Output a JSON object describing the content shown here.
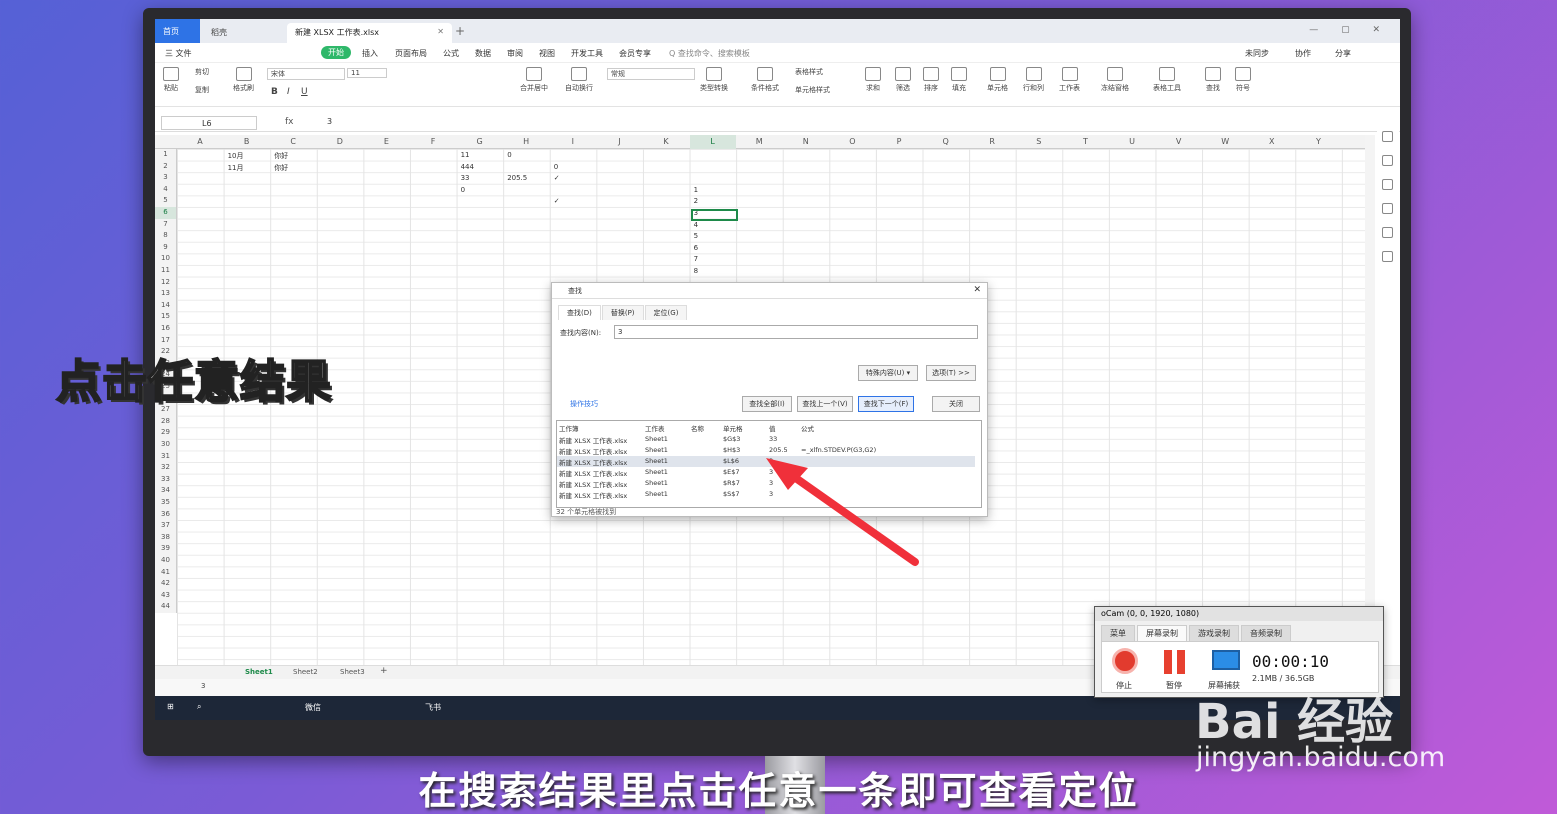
{
  "tabs": {
    "home": "首页",
    "t2": "稻壳",
    "t3": "新建 XLSX 工作表.xlsx"
  },
  "menu": [
    "三 文件",
    "开始",
    "插入",
    "页面布局",
    "公式",
    "数据",
    "审阅",
    "视图",
    "开发工具",
    "会员专享",
    "Q 查找命令、搜索模板"
  ],
  "menu_right": [
    "未同步",
    "协作",
    "分享"
  ],
  "ribbon": [
    "粘贴",
    "剪切",
    "复制",
    "格式刷",
    "宋体",
    "11",
    "B",
    "I",
    "U",
    "合并居中",
    "自动换行",
    "常规",
    "类型转换",
    "条件格式",
    "表格样式",
    "单元格样式",
    "求和",
    "筛选",
    "排序",
    "填充",
    "单元格",
    "行和列",
    "工作表",
    "冻结窗格",
    "表格工具",
    "查找",
    "符号"
  ],
  "formula": {
    "namebox": "L6",
    "fx": "fx",
    "value": "3"
  },
  "columns": [
    "A",
    "B",
    "C",
    "D",
    "E",
    "F",
    "G",
    "H",
    "I",
    "J",
    "K",
    "L",
    "M",
    "N",
    "O",
    "P",
    "Q",
    "R",
    "S",
    "T",
    "U",
    "V",
    "W",
    "X",
    "Y"
  ],
  "rows": [
    "1",
    "2",
    "3",
    "4",
    "5",
    "6",
    "7",
    "8",
    "9",
    "10",
    "11",
    "12",
    "13",
    "14",
    "15",
    "16",
    "17",
    "22",
    "23",
    "24",
    "25",
    "26",
    "27",
    "28",
    "29",
    "30",
    "31",
    "32",
    "33",
    "34",
    "35",
    "36",
    "37",
    "38",
    "39",
    "40",
    "41",
    "42",
    "43",
    "44"
  ],
  "cells": [
    {
      "c": 1,
      "r": 0,
      "t": "10月"
    },
    {
      "c": 1,
      "r": 1,
      "t": "11月"
    },
    {
      "c": 2,
      "r": 0,
      "t": "你好"
    },
    {
      "c": 2,
      "r": 1,
      "t": "你好"
    },
    {
      "c": 6,
      "r": 0,
      "t": "11"
    },
    {
      "c": 6,
      "r": 1,
      "t": "444"
    },
    {
      "c": 6,
      "r": 2,
      "t": "33"
    },
    {
      "c": 6,
      "r": 3,
      "t": "0"
    },
    {
      "c": 7,
      "r": 0,
      "t": "0"
    },
    {
      "c": 7,
      "r": 2,
      "t": "205.5"
    },
    {
      "c": 8,
      "r": 2,
      "t": "✓"
    },
    {
      "c": 8,
      "r": 4,
      "t": "✓"
    },
    {
      "c": 8,
      "r": 1,
      "t": "0"
    },
    {
      "c": 11,
      "r": 3,
      "t": "1"
    },
    {
      "c": 11,
      "r": 4,
      "t": "2"
    },
    {
      "c": 11,
      "r": 5,
      "t": "3"
    },
    {
      "c": 11,
      "r": 6,
      "t": "4"
    },
    {
      "c": 11,
      "r": 7,
      "t": "5"
    },
    {
      "c": 11,
      "r": 8,
      "t": "6"
    },
    {
      "c": 11,
      "r": 9,
      "t": "7"
    },
    {
      "c": 11,
      "r": 10,
      "t": "8"
    }
  ],
  "sheets": [
    "Sheet1",
    "Sheet2",
    "Sheet3",
    "+"
  ],
  "status": "3",
  "find_dialog": {
    "title": "查找",
    "tabs": [
      "查找(D)",
      "替换(P)",
      "定位(G)"
    ],
    "label": "查找内容(N):",
    "value": "3",
    "special_btn": "特殊内容(U) ▾",
    "options_btn": "选项(T) >>",
    "tips": "操作技巧",
    "btn_all": "查找全部(I)",
    "btn_prev": "查找上一个(V)",
    "btn_next": "查找下一个(F)",
    "btn_close": "关闭",
    "headers": [
      "工作簿",
      "工作表",
      "名称",
      "单元格",
      "值",
      "公式"
    ],
    "results": [
      [
        "新建 XLSX 工作表.xlsx",
        "Sheet1",
        "",
        "$G$3",
        "33",
        ""
      ],
      [
        "新建 XLSX 工作表.xlsx",
        "Sheet1",
        "",
        "$H$3",
        "205.5",
        "=_xlfn.STDEV.P(G3,G2)"
      ],
      [
        "新建 XLSX 工作表.xlsx",
        "Sheet1",
        "",
        "$L$6",
        "3",
        ""
      ],
      [
        "新建 XLSX 工作表.xlsx",
        "Sheet1",
        "",
        "$E$7",
        "3",
        ""
      ],
      [
        "新建 XLSX 工作表.xlsx",
        "Sheet1",
        "",
        "$R$7",
        "3",
        ""
      ],
      [
        "新建 XLSX 工作表.xlsx",
        "Sheet1",
        "",
        "$S$7",
        "3",
        ""
      ]
    ],
    "footer": "32 个单元格被找到"
  },
  "ocam": {
    "title": "oCam (0, 0, 1920, 1080)",
    "tabs": [
      "菜单",
      "屏幕录制",
      "游戏录制",
      "音频录制"
    ],
    "labels": [
      "停止",
      "暂停",
      "屏幕捕获"
    ],
    "time": "00:00:10",
    "size": "2.1MB / 36.5GB"
  },
  "taskbar": [
    "微信",
    "飞书"
  ],
  "caption_left": "点击任意结果",
  "caption_bottom": "在搜索结果里点击任意一条即可查看定位",
  "watermark": {
    "logo": "Bai 经验",
    "url": "jingyan.baidu.com"
  },
  "colors": {
    "accent": "#2e73e6",
    "wps_green": "#2fb86a",
    "arrow": "#f0303a"
  }
}
